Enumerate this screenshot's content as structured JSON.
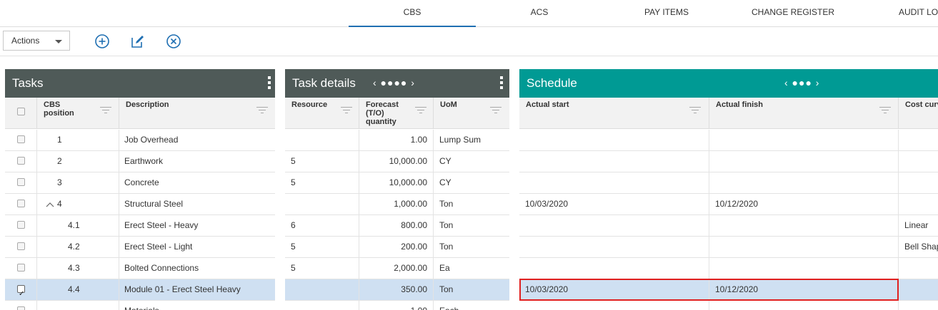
{
  "nav": {
    "tabs": [
      {
        "label": "CBS",
        "active": true
      },
      {
        "label": "ACS",
        "active": false
      },
      {
        "label": "PAY ITEMS",
        "active": false
      },
      {
        "label": "CHANGE REGISTER",
        "active": false
      },
      {
        "label": "AUDIT LOG",
        "active": false
      }
    ]
  },
  "toolbar": {
    "actions_label": "Actions",
    "icons": [
      "add-icon",
      "edit-icon",
      "cancel-icon"
    ]
  },
  "tasks": {
    "title": "Tasks",
    "columns": [
      "CBS position",
      "Description"
    ],
    "rows": [
      {
        "pos": "1",
        "desc": "Job Overhead",
        "checked": false,
        "expand": ""
      },
      {
        "pos": "2",
        "desc": "Earthwork",
        "checked": false,
        "expand": ""
      },
      {
        "pos": "3",
        "desc": "Concrete",
        "checked": false,
        "expand": ""
      },
      {
        "pos": "4",
        "desc": "Structural Steel",
        "checked": false,
        "expand": "^"
      },
      {
        "pos": "4.1",
        "desc": "Erect Steel - Heavy",
        "checked": false,
        "expand": ""
      },
      {
        "pos": "4.2",
        "desc": "Erect Steel - Light",
        "checked": false,
        "expand": ""
      },
      {
        "pos": "4.3",
        "desc": "Bolted Connections",
        "checked": false,
        "expand": ""
      },
      {
        "pos": "4.4",
        "desc": "Module 01 - Erect Steel Heavy",
        "checked": true,
        "expand": ""
      },
      {
        "pos": "",
        "desc": "Materials",
        "checked": false,
        "expand": ""
      }
    ]
  },
  "task_details": {
    "title": "Task details",
    "pager": "‹ ●●●● ›",
    "columns": [
      "Resource",
      "Forecast (T/O) quantity",
      "UoM"
    ],
    "rows": [
      {
        "resource": "",
        "qty": "1.00",
        "uom": "Lump Sum"
      },
      {
        "resource": "5",
        "qty": "10,000.00",
        "uom": "CY"
      },
      {
        "resource": "5",
        "qty": "10,000.00",
        "uom": "CY"
      },
      {
        "resource": "",
        "qty": "1,000.00",
        "uom": "Ton"
      },
      {
        "resource": "6",
        "qty": "800.00",
        "uom": "Ton"
      },
      {
        "resource": "5",
        "qty": "200.00",
        "uom": "Ton"
      },
      {
        "resource": "5",
        "qty": "2,000.00",
        "uom": "Ea"
      },
      {
        "resource": "",
        "qty": "350.00",
        "uom": "Ton"
      },
      {
        "resource": "",
        "qty": "1.00",
        "uom": "Each"
      }
    ]
  },
  "schedule": {
    "title": "Schedule",
    "pager": "‹ ●●● ›",
    "columns": [
      "Actual start",
      "Actual finish",
      "Cost curve"
    ],
    "rows": [
      {
        "start": "",
        "finish": "",
        "curve": ""
      },
      {
        "start": "",
        "finish": "",
        "curve": ""
      },
      {
        "start": "",
        "finish": "",
        "curve": ""
      },
      {
        "start": "10/03/2020",
        "finish": "10/12/2020",
        "curve": ""
      },
      {
        "start": "",
        "finish": "",
        "curve": "Linear"
      },
      {
        "start": "",
        "finish": "",
        "curve": "Bell Shape"
      },
      {
        "start": "",
        "finish": "",
        "curve": ""
      },
      {
        "start": "10/03/2020",
        "finish": "10/12/2020",
        "curve": ""
      },
      {
        "start": "",
        "finish": "",
        "curve": ""
      }
    ]
  },
  "colors": {
    "tasks_header": "#4f5a58",
    "schedule_header": "#009a94",
    "selected_row": "#cfe0f2",
    "highlight_border": "#e02020",
    "active_tab": "#1f6fb2"
  }
}
